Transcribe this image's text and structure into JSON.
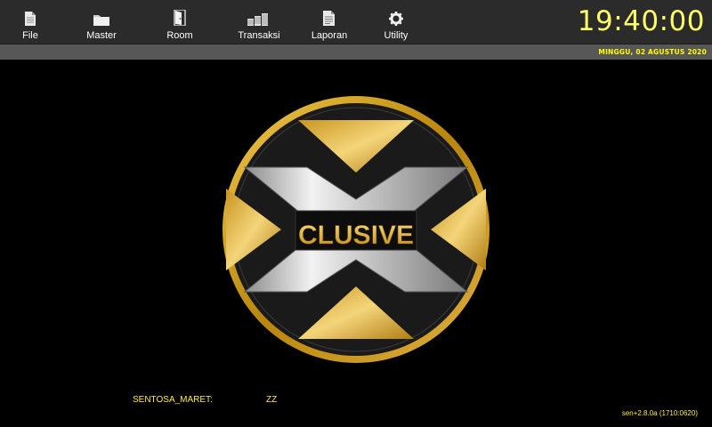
{
  "menu": [
    {
      "label": "File",
      "icon": "file-icon"
    },
    {
      "label": "Master",
      "icon": "folder-icon"
    },
    {
      "label": "Room",
      "icon": "door-icon"
    },
    {
      "label": "Transaksi",
      "icon": "coins-icon"
    },
    {
      "label": "Laporan",
      "icon": "report-icon"
    },
    {
      "label": "Utility",
      "icon": "gear-icon"
    }
  ],
  "clock": {
    "time": "19:40:00",
    "date": "MINGGU, 02 AGUSTUS 2020"
  },
  "logo": {
    "text": "CLUSIVE",
    "gold": "#d4a52a",
    "silver": "#c8c8c8"
  },
  "footer": {
    "company": "SENTOSA_MARET:",
    "code": "ZZ",
    "version": "sen+2.8.0a (1710:0620)"
  },
  "colors": {
    "accent_yellow": "#ffff66",
    "menubar": "#2b2b2b",
    "datebar": "#575757"
  }
}
